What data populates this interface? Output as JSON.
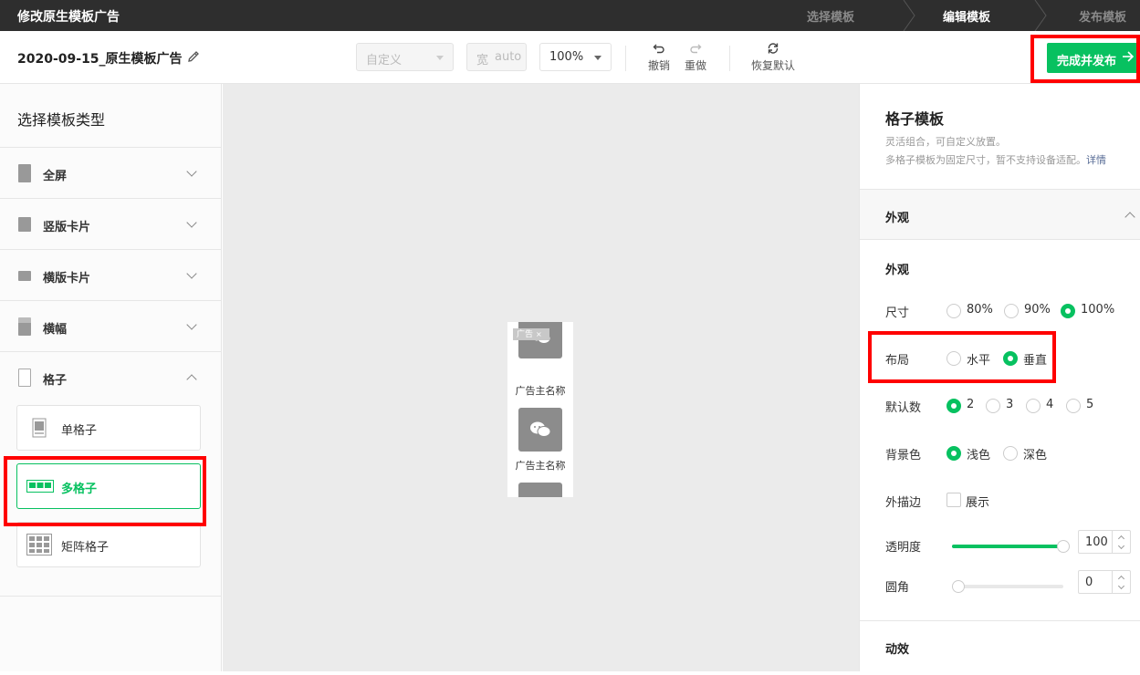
{
  "topbar": {
    "title": "修改原生模板广告",
    "steps": [
      "选择模板",
      "编辑模板",
      "发布模板"
    ]
  },
  "toolbar": {
    "doc_name": "2020-09-15_原生模板广告",
    "custom_select": "自定义",
    "width_label": "宽",
    "width_value": "auto",
    "zoom": "100%",
    "undo": "撤销",
    "redo": "重做",
    "reset": "恢复默认",
    "publish": "完成并发布"
  },
  "left": {
    "title": "选择模板类型",
    "categories": [
      {
        "label": "全屏"
      },
      {
        "label": "竖版卡片"
      },
      {
        "label": "横版卡片"
      },
      {
        "label": "横幅"
      },
      {
        "label": "格子"
      }
    ],
    "subitems": [
      {
        "label": "单格子"
      },
      {
        "label": "多格子"
      },
      {
        "label": "矩阵格子"
      }
    ]
  },
  "preview": {
    "ad_tag": "广告",
    "ad_close": "×",
    "items": [
      {
        "name": "广告主名称"
      },
      {
        "name": "广告主名称"
      }
    ]
  },
  "right": {
    "title": "格子模板",
    "desc1": "灵活组合，可自定义放置。",
    "desc2": "多格子模板为固定尺寸，暂不支持设备适配。",
    "desc_link": "详情",
    "section_appearance": "外观",
    "sub_appearance": "外观",
    "size": {
      "label": "尺寸",
      "options": [
        "80%",
        "90%",
        "100%"
      ],
      "selected": "100%"
    },
    "layout": {
      "label": "布局",
      "options": [
        "水平",
        "垂直"
      ],
      "selected": "垂直"
    },
    "count": {
      "label": "默认数",
      "options": [
        "2",
        "3",
        "4",
        "5"
      ],
      "selected": "2"
    },
    "bg": {
      "label": "背景色",
      "options": [
        "浅色",
        "深色"
      ],
      "selected": "浅色"
    },
    "border": {
      "label": "外描边",
      "option": "展示",
      "checked": false
    },
    "opacity": {
      "label": "透明度",
      "value": "100",
      "percent": 100
    },
    "radius": {
      "label": "圆角",
      "value": "0",
      "percent": 0
    },
    "section_motion": "动效"
  },
  "colors": {
    "accent": "#07c160",
    "topbar": "#2e2e2e",
    "highlight": "#ff0000"
  }
}
